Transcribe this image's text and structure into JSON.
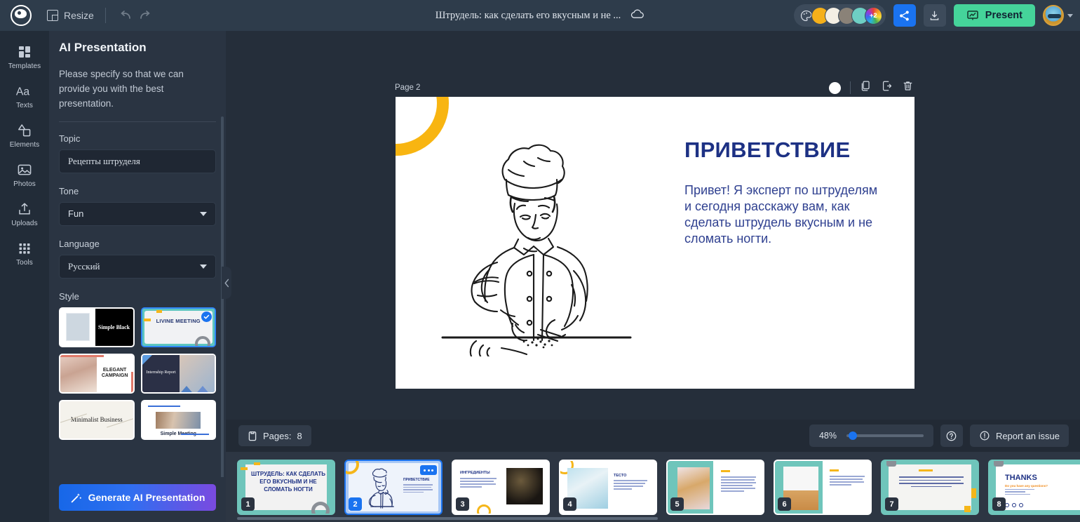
{
  "topbar": {
    "logo_name": "app-logo",
    "resize_label": "Resize",
    "doc_title": "Штрудель: как сделать его вкусным и не ...",
    "swatch_more_label": "+2",
    "swatch_colors": [
      "#f5b01a",
      "#f4efe4",
      "#8a8278",
      "#6ecfc4"
    ],
    "present_label": "Present",
    "share_icon": "share-icon",
    "download_icon": "download-icon",
    "cloud_icon": "cloud-saved-icon",
    "palette_icon": "palette-icon",
    "accent_blue": "#1a73f0",
    "present_green": "#45d49a"
  },
  "rail": {
    "items": [
      {
        "label": "Templates",
        "icon": "templates-icon"
      },
      {
        "label": "Texts",
        "icon": "texts-icon"
      },
      {
        "label": "Elements",
        "icon": "elements-icon"
      },
      {
        "label": "Photos",
        "icon": "photos-icon"
      },
      {
        "label": "Uploads",
        "icon": "uploads-icon"
      },
      {
        "label": "Tools",
        "icon": "tools-icon"
      }
    ]
  },
  "panel": {
    "title": "AI Presentation",
    "description": "Please specify so that we can provide you with the best presentation.",
    "topic": {
      "label": "Topic",
      "value": "Рецепты штруделя"
    },
    "tone": {
      "label": "Tone",
      "value": "Fun"
    },
    "language": {
      "label": "Language",
      "value": "Русский"
    },
    "style": {
      "label": "Style",
      "cards": [
        {
          "name": "Simple Black",
          "selected": false
        },
        {
          "name": "LIVINE MEETING",
          "selected": true
        },
        {
          "name": "ELEGANT CAMPAIGN",
          "selected": false
        },
        {
          "name": "Internship Report",
          "selected": false
        },
        {
          "name": "Minimalist Business",
          "selected": false
        },
        {
          "name": "Simple Meeting",
          "selected": false
        }
      ]
    },
    "generate_label": "Generate AI Presentation"
  },
  "canvas": {
    "page_label": "Page 2",
    "tools": [
      "record-dot",
      "duplicate-icon",
      "export-icon",
      "delete-icon"
    ],
    "slide": {
      "heading": "ПРИВЕТСТВИЕ",
      "body": "Привет! Я эксперт по штруделям и сегодня расскажу вам, как сделать штрудель вкусным и не сломать ногти.",
      "accent_yellow": "#f8b511",
      "text_blue": "#1d3184"
    }
  },
  "bottombar": {
    "pages_label": "Pages:",
    "pages_count": "8",
    "zoom_value": "48%",
    "help_icon": "help-icon",
    "report_label": "Report an issue"
  },
  "thumbnails": [
    {
      "num": "1",
      "title": "ШТРУДЕЛЬ: КАК СДЕЛАТЬ ЕГО ВКУСНЫМ И НЕ СЛОМАТЬ НОГТИ",
      "active": false
    },
    {
      "num": "2",
      "title": "ПРИВЕТСТВИЕ",
      "active": true
    },
    {
      "num": "3",
      "title": "ИНГРЕДИЕНТЫ",
      "active": false
    },
    {
      "num": "4",
      "title": "ТЕСТО",
      "active": false
    },
    {
      "num": "5",
      "title": "",
      "active": false
    },
    {
      "num": "6",
      "title": "",
      "active": false
    },
    {
      "num": "7",
      "title": "ГОТОВО!",
      "active": false
    },
    {
      "num": "8",
      "title": "THANKS",
      "active": false
    }
  ]
}
